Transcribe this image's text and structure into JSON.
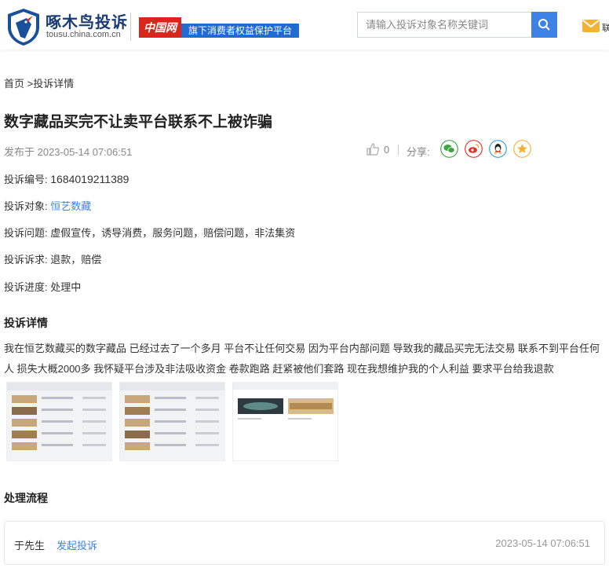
{
  "header": {
    "logo_cn": "啄木鸟投诉",
    "logo_url": "tousu.china.com.cn",
    "partner_logo": "中国网",
    "partner_tag": "旗下消费者权益保护平台",
    "search_placeholder": "请输入投诉对象名称关键词",
    "contact_label": "联",
    "accent_color": "#3e82e6"
  },
  "breadcrumb": {
    "home": "首页",
    "sep": " >",
    "current": "投诉详情"
  },
  "complaint": {
    "title": "数字藏品买完不让卖平台联系不上被诈骗",
    "published": "发布于 2023-05-14 07:06:51",
    "like_count": "0",
    "share_label": "分享:",
    "share_icons": [
      "wechat-icon",
      "weibo-icon",
      "qq-icon",
      "qzone-icon"
    ],
    "fields": [
      {
        "label": "投诉编号:",
        "value": "1684019211389"
      },
      {
        "label": "投诉对象:",
        "value": "恒艺数藏"
      },
      {
        "label": "投诉问题:",
        "value": "虚假宣传，诱导消费，服务问题，赔偿问题，非法集资"
      },
      {
        "label": "投诉诉求:",
        "value": "退款，赔偿"
      },
      {
        "label": "投诉进度:",
        "value": "处理中"
      }
    ],
    "detail_heading": "投诉详情",
    "detail_text": "我在恒艺数藏买的数字藏品 已经过去了一个多月 平台不让任何交易 因为平台内部问题 导致我的藏品买完无法交易 联系不到平台任何人 损失大概2000多 我怀疑平台涉及非法吸收资金 卷款跑路 赶紧被他们套路 现在我想维护我的个人利益 要求平台给我退款"
  },
  "process": {
    "heading": "处理流程",
    "steps": [
      {
        "name": "于先生",
        "action": "发起投诉",
        "time": "2023-05-14 07:06:51"
      }
    ]
  }
}
